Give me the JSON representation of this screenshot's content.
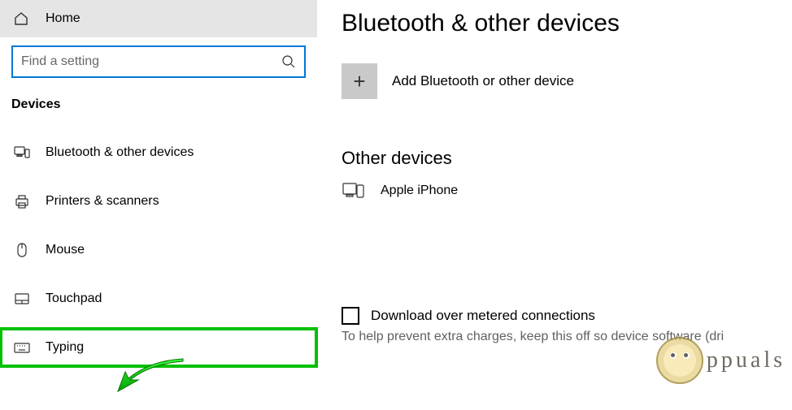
{
  "sidebar": {
    "home_label": "Home",
    "search_placeholder": "Find a setting",
    "category_label": "Devices",
    "items": [
      {
        "label": "Bluetooth & other devices",
        "icon": "bluetooth-devices-icon"
      },
      {
        "label": "Printers & scanners",
        "icon": "printer-icon"
      },
      {
        "label": "Mouse",
        "icon": "mouse-icon"
      },
      {
        "label": "Touchpad",
        "icon": "touchpad-icon"
      },
      {
        "label": "Typing",
        "icon": "keyboard-icon"
      }
    ]
  },
  "content": {
    "page_title": "Bluetooth & other devices",
    "add_label": "Add Bluetooth or other device",
    "other_devices_title": "Other devices",
    "devices": [
      {
        "label": "Apple iPhone",
        "icon": "phone-icon"
      }
    ],
    "download_label": "Download over metered connections",
    "download_checked": false,
    "tip_text": "To help prevent extra charges, keep this off so device software (dri"
  },
  "watermark": {
    "text": "ppuals"
  }
}
